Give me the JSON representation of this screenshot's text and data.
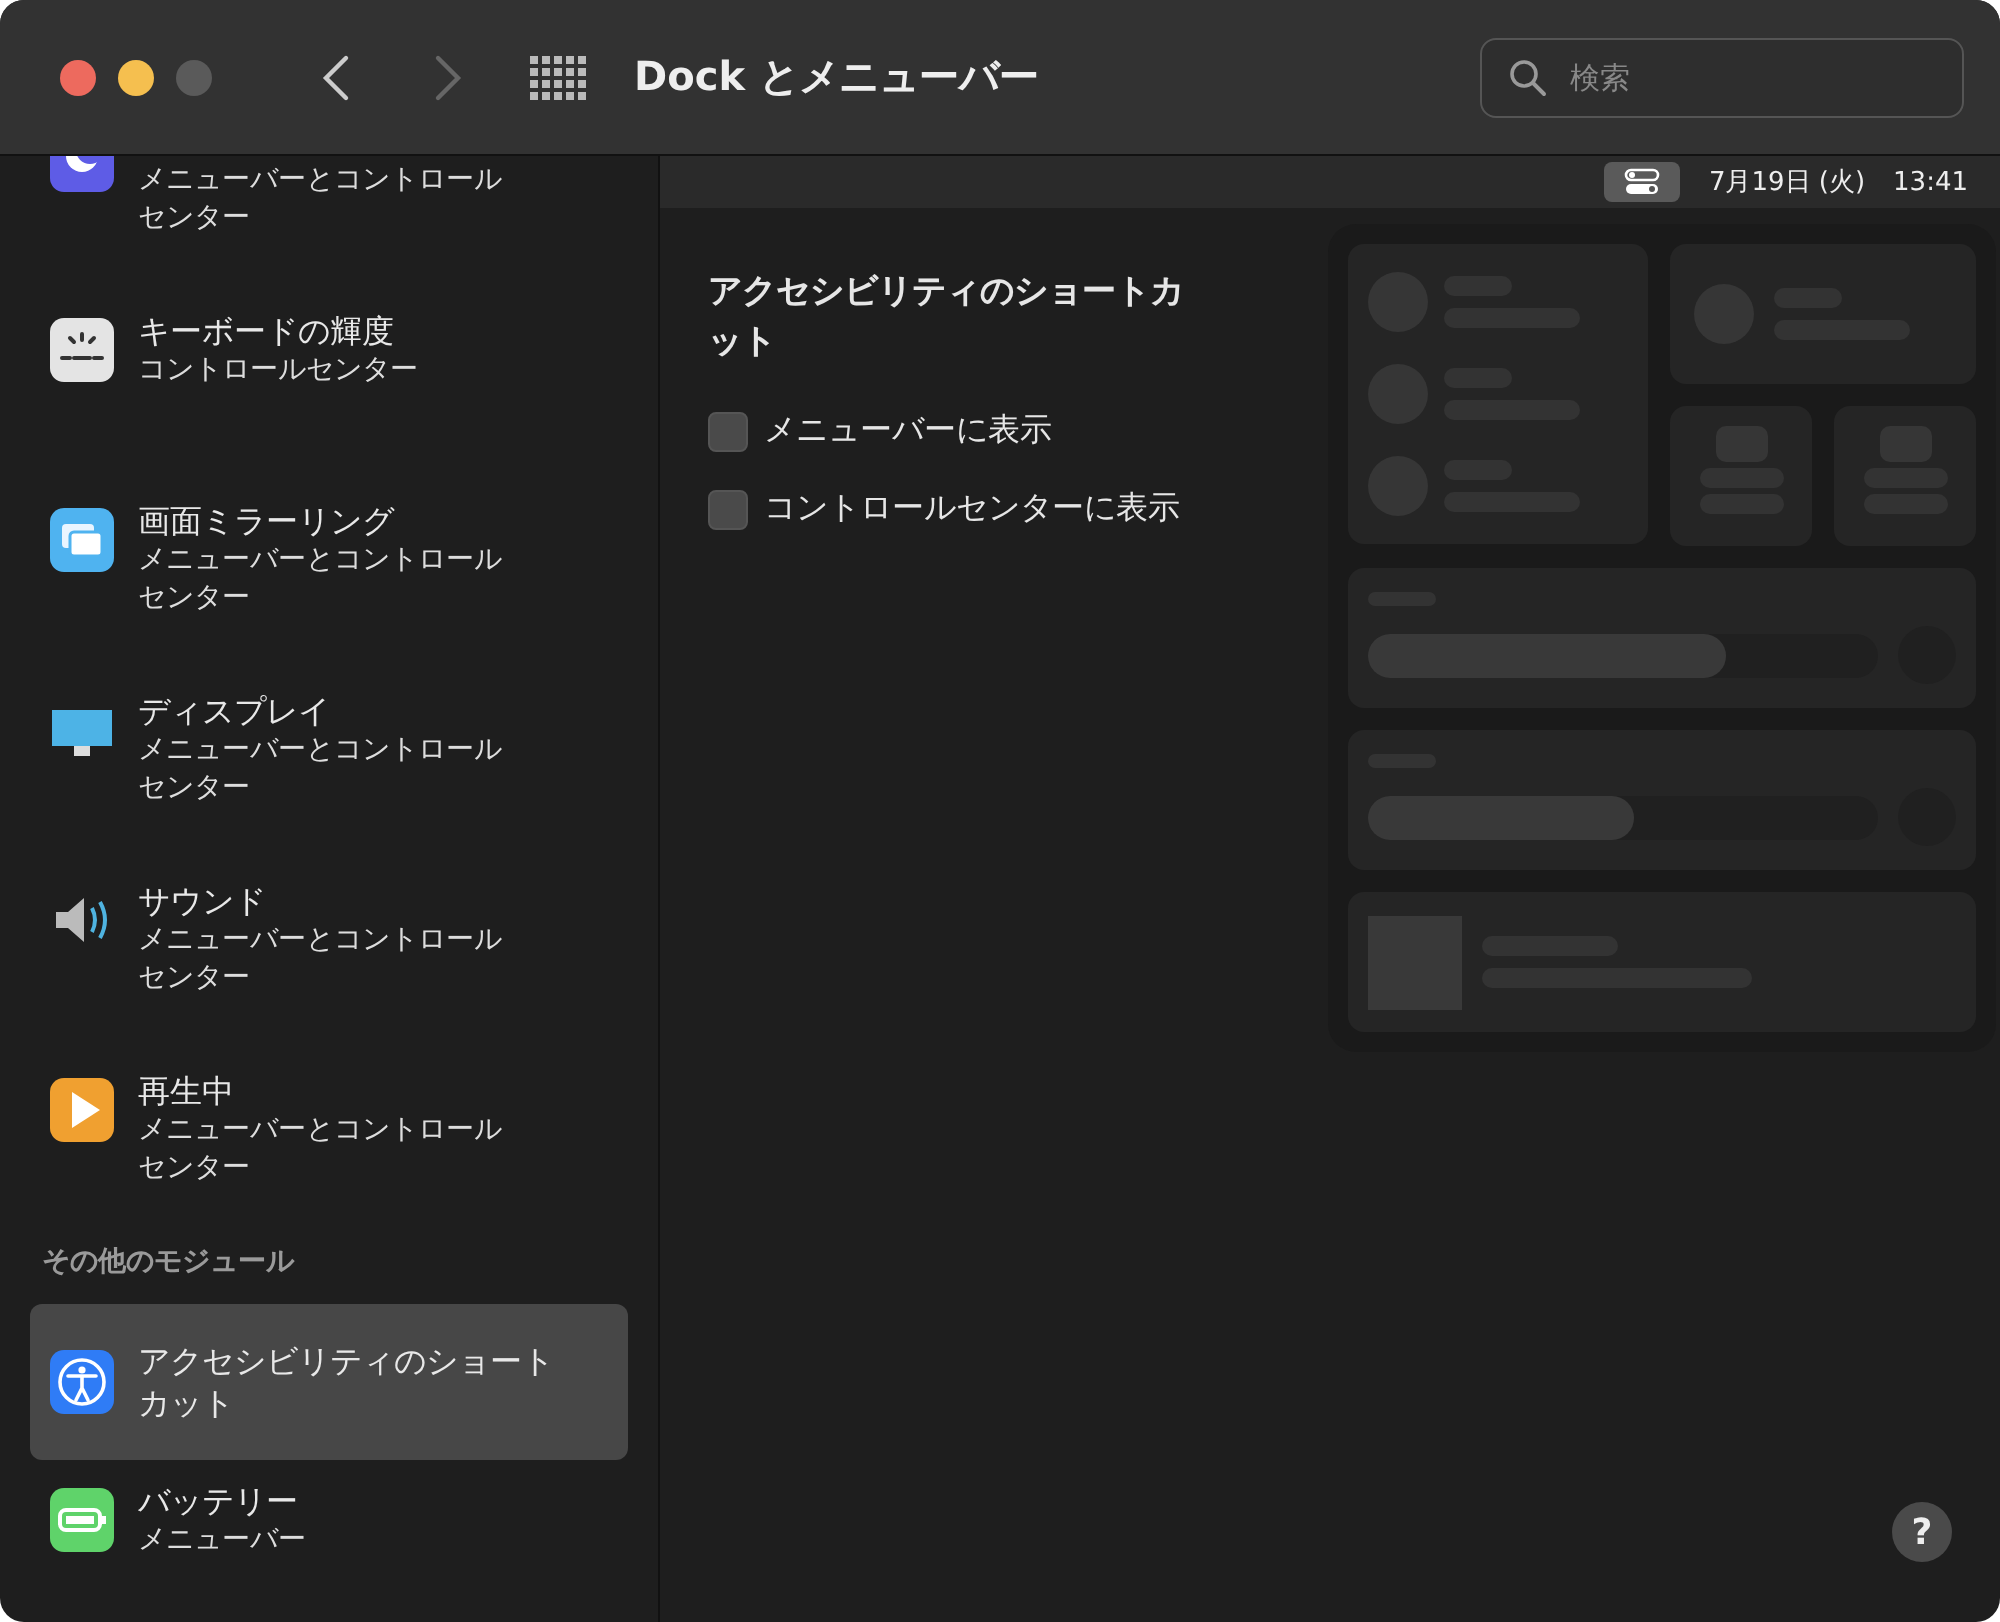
{
  "window": {
    "title": "Dock とメニューバー",
    "back": {
      "disabled": false
    },
    "forward": {
      "disabled": true
    }
  },
  "search": {
    "placeholder": "検索"
  },
  "sidebar": {
    "groups": [
      {
        "items": [
          {
            "kind": "moon",
            "subtitle": "メニューバーとコントロールセンター",
            "selected": false
          },
          {
            "kind": "keyboard-brightness",
            "title": "キーボードの輝度",
            "subtitle": "コントロールセンター",
            "selected": false
          },
          {
            "kind": "screen-mirroring",
            "title": "画面ミラーリング",
            "subtitle": "メニューバーとコントロールセンター",
            "selected": false
          },
          {
            "kind": "display",
            "title": "ディスプレイ",
            "subtitle": "メニューバーとコントロールセンター",
            "selected": false
          },
          {
            "kind": "sound",
            "title": "サウンド",
            "subtitle": "メニューバーとコントロールセンター",
            "selected": false
          },
          {
            "kind": "play",
            "title": "再生中",
            "subtitle": "メニューバーとコントロールセンター",
            "selected": false
          }
        ]
      },
      {
        "header": "その他のモジュール",
        "items": [
          {
            "kind": "accessibility",
            "title": "アクセシビリティのショートカット",
            "selected": true
          },
          {
            "kind": "battery",
            "title": "バッテリー",
            "subtitle": "メニューバー",
            "selected": false
          }
        ]
      }
    ]
  },
  "menu_bar_preview": {
    "date": "7月19日 (火)",
    "time": "13:41"
  },
  "panel": {
    "title": "アクセシビリティのショートカット",
    "options": [
      {
        "label": "メニューバーに表示",
        "checked": false
      },
      {
        "label": "コントロールセンターに表示",
        "checked": false
      }
    ]
  },
  "help_button": "?"
}
